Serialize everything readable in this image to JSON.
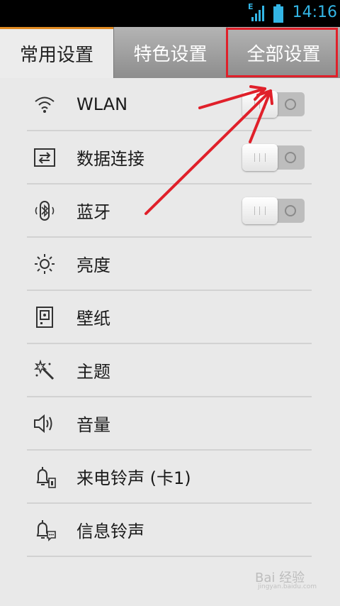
{
  "status_bar": {
    "network_type": "E",
    "time": "14:16",
    "signal_icon": "signal-icon",
    "battery_icon": "battery-icon"
  },
  "tabs": [
    {
      "label": "常用设置",
      "active": true
    },
    {
      "label": "特色设置",
      "active": false
    },
    {
      "label": "全部设置",
      "active": false
    }
  ],
  "items": [
    {
      "label": "WLAN",
      "icon": "wifi-icon",
      "toggle": "off"
    },
    {
      "label": "数据连接",
      "icon": "data-connection-icon",
      "toggle": "off"
    },
    {
      "label": "蓝牙",
      "icon": "bluetooth-icon",
      "toggle": "off"
    },
    {
      "label": "亮度",
      "icon": "brightness-icon"
    },
    {
      "label": "壁纸",
      "icon": "wallpaper-icon"
    },
    {
      "label": "主题",
      "icon": "theme-icon"
    },
    {
      "label": "音量",
      "icon": "volume-icon"
    },
    {
      "label": "来电铃声 (卡1)",
      "icon": "ringtone-icon"
    },
    {
      "label": "信息铃声",
      "icon": "message-tone-icon"
    }
  ],
  "colors": {
    "accent": "#33b5e5",
    "tab_indicator": "#e08a22",
    "annotation": "#e0202a"
  },
  "watermark": {
    "brand": "Bai 经验",
    "url": "jingyan.baidu.com"
  }
}
